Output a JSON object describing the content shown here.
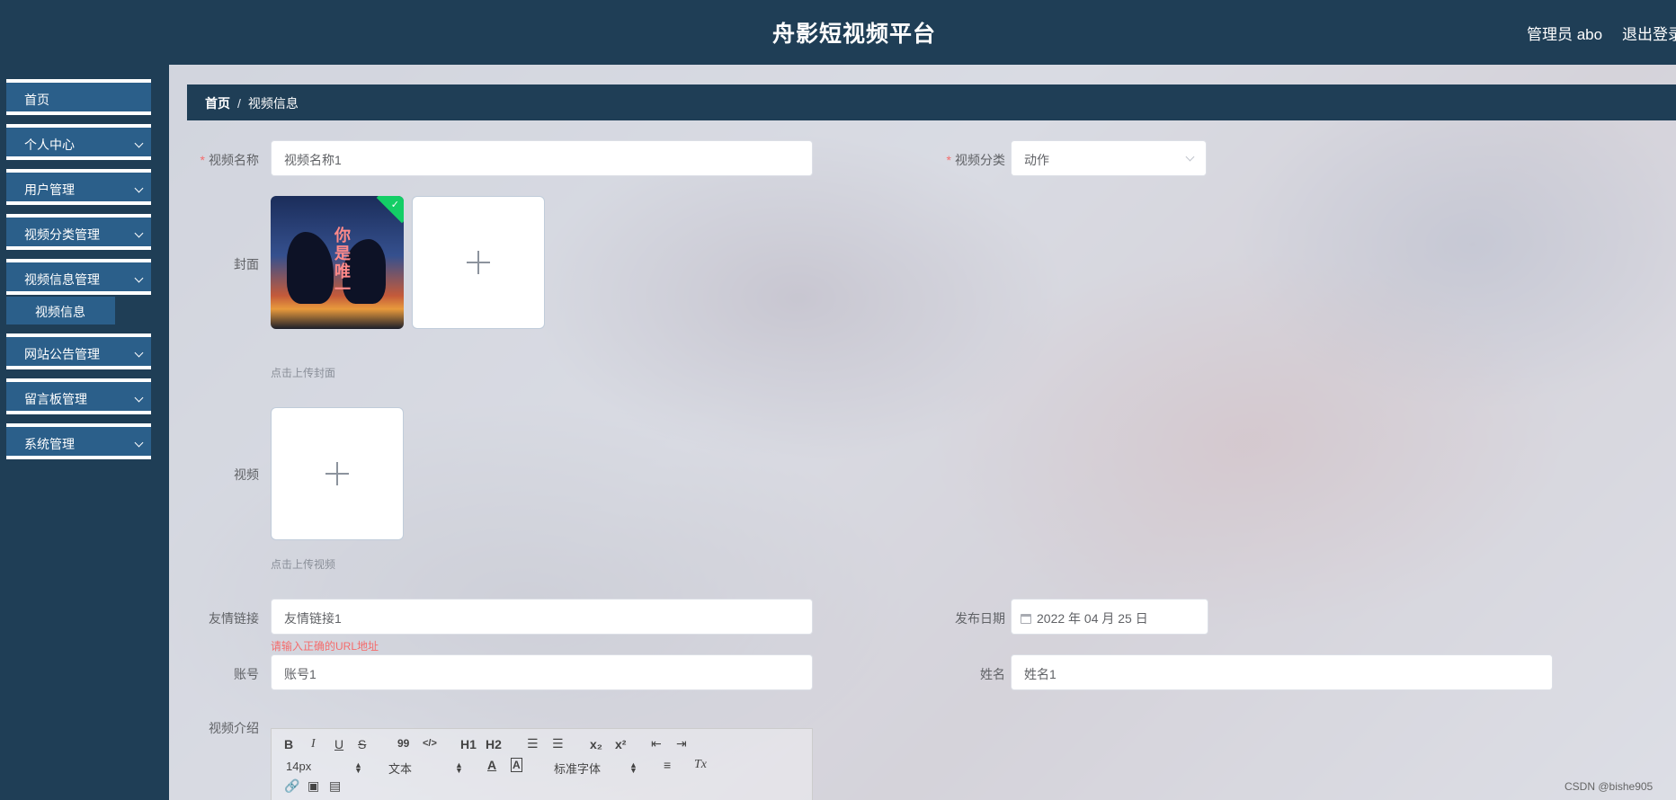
{
  "header": {
    "title": "舟影短视频平台",
    "user": "管理员 abo",
    "logout": "退出登录"
  },
  "sidebar": {
    "items": [
      {
        "label": "首页"
      },
      {
        "label": "个人中心"
      },
      {
        "label": "用户管理"
      },
      {
        "label": "视频分类管理"
      },
      {
        "label": "视频信息管理"
      },
      {
        "label": "网站公告管理"
      },
      {
        "label": "留言板管理"
      },
      {
        "label": "系统管理"
      }
    ],
    "submenu_active": "视频信息"
  },
  "breadcrumb": {
    "home": "首页",
    "sep": "/",
    "current": "视频信息"
  },
  "form": {
    "name": {
      "label": "视频名称",
      "value": "视频名称1"
    },
    "category": {
      "label": "视频分类",
      "value": "动作"
    },
    "cover": {
      "label": "封面",
      "hint": "点击上传封面",
      "image_text": "你是唯一"
    },
    "video": {
      "label": "视频",
      "hint": "点击上传视频"
    },
    "link": {
      "label": "友情链接",
      "value": "友情链接1",
      "error": "请输入正确的URL地址"
    },
    "date": {
      "label": "发布日期",
      "value": "2022 年 04 月 25 日"
    },
    "account": {
      "label": "账号",
      "value": "账号1"
    },
    "realname": {
      "label": "姓名",
      "value": "姓名1"
    },
    "intro": {
      "label": "视频介绍"
    }
  },
  "editor": {
    "size": "14px",
    "format": "文本",
    "font": "标准字体",
    "bold": "B",
    "italic": "I",
    "underline": "U",
    "strike": "S",
    "quote": "99",
    "code": "</>",
    "h1": "H1",
    "h2": "H2",
    "sub": "x₂",
    "sup": "x²",
    "clean": "Tx"
  },
  "watermark": "CSDN @bishe905"
}
